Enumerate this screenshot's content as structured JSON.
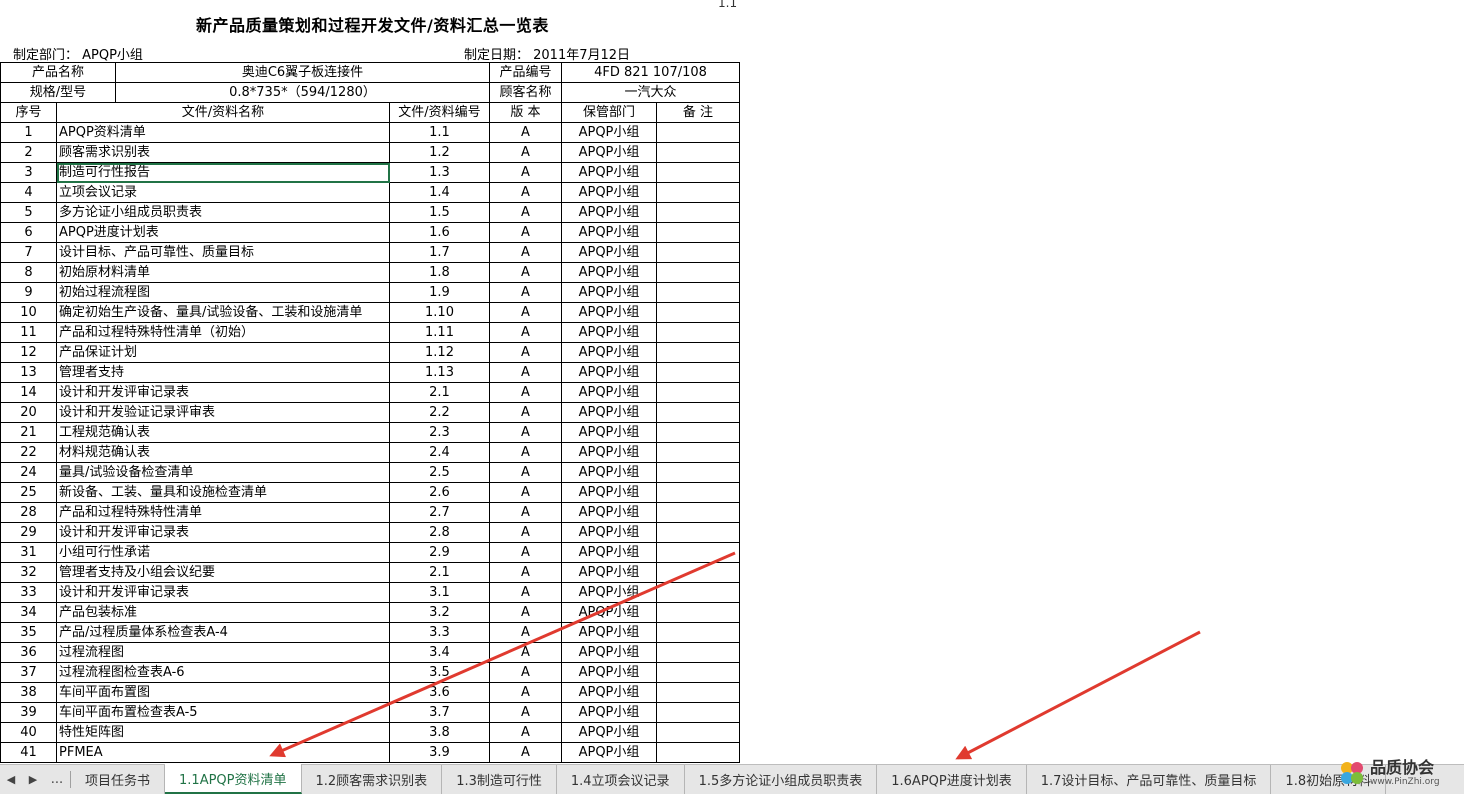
{
  "corner_label": "1.1",
  "title": "新产品质量策划和过程开发文件/资料汇总一览表",
  "dept_label": "制定部门：  APQP小组",
  "date_label": "制定日期：  2011年7月12日",
  "info": {
    "product_name_label": "产品名称",
    "product_name": "奥迪C6翼子板连接件",
    "product_no_label": "产品编号",
    "product_no": "4FD 821 107/108",
    "spec_label": "规格/型号",
    "spec": "0.8*735*（594/1280）",
    "customer_label": "顾客名称",
    "customer": "一汽大众"
  },
  "headers": [
    "序号",
    "文件/资料名称",
    "文件/资料编号",
    "版 本",
    "保管部门",
    "备 注"
  ],
  "rows": [
    [
      "1",
      "APQP资料清单",
      "1.1",
      "A",
      "APQP小组",
      ""
    ],
    [
      "2",
      "顾客需求识别表",
      "1.2",
      "A",
      "APQP小组",
      ""
    ],
    [
      "3",
      "制造可行性报告",
      "1.3",
      "A",
      "APQP小组",
      ""
    ],
    [
      "4",
      "立项会议记录",
      "1.4",
      "A",
      "APQP小组",
      ""
    ],
    [
      "5",
      "多方论证小组成员职责表",
      "1.5",
      "A",
      "APQP小组",
      ""
    ],
    [
      "6",
      "APQP进度计划表",
      "1.6",
      "A",
      "APQP小组",
      ""
    ],
    [
      "7",
      "设计目标、产品可靠性、质量目标",
      "1.7",
      "A",
      "APQP小组",
      ""
    ],
    [
      "8",
      "初始原材料清单",
      "1.8",
      "A",
      "APQP小组",
      ""
    ],
    [
      "9",
      "初始过程流程图",
      "1.9",
      "A",
      "APQP小组",
      ""
    ],
    [
      "10",
      "确定初始生产设备、量具/试验设备、工装和设施清单",
      "1.10",
      "A",
      "APQP小组",
      ""
    ],
    [
      "11",
      "产品和过程特殊特性清单（初始）",
      "1.11",
      "A",
      "APQP小组",
      ""
    ],
    [
      "12",
      "产品保证计划",
      "1.12",
      "A",
      "APQP小组",
      ""
    ],
    [
      "13",
      "管理者支持",
      "1.13",
      "A",
      "APQP小组",
      ""
    ],
    [
      "14",
      "设计和开发评审记录表",
      "2.1",
      "A",
      "APQP小组",
      ""
    ],
    [
      "20",
      "设计和开发验证记录评审表",
      "2.2",
      "A",
      "APQP小组",
      ""
    ],
    [
      "21",
      "工程规范确认表",
      "2.3",
      "A",
      "APQP小组",
      ""
    ],
    [
      "22",
      "材料规范确认表",
      "2.4",
      "A",
      "APQP小组",
      ""
    ],
    [
      "24",
      "量具/试验设备检查清单",
      "2.5",
      "A",
      "APQP小组",
      ""
    ],
    [
      "25",
      "新设备、工装、量具和设施检查清单",
      "2.6",
      "A",
      "APQP小组",
      ""
    ],
    [
      "28",
      "产品和过程特殊特性清单",
      "2.7",
      "A",
      "APQP小组",
      ""
    ],
    [
      "29",
      "设计和开发评审记录表",
      "2.8",
      "A",
      "APQP小组",
      ""
    ],
    [
      "31",
      "小组可行性承诺",
      "2.9",
      "A",
      "APQP小组",
      ""
    ],
    [
      "32",
      "管理者支持及小组会议纪要",
      "2.1",
      "A",
      "APQP小组",
      ""
    ],
    [
      "33",
      "设计和开发评审记录表",
      "3.1",
      "A",
      "APQP小组",
      ""
    ],
    [
      "34",
      "产品包装标准",
      "3.2",
      "A",
      "APQP小组",
      ""
    ],
    [
      "35",
      "产品/过程质量体系检查表A-4",
      "3.3",
      "A",
      "APQP小组",
      ""
    ],
    [
      "36",
      "过程流程图",
      "3.4",
      "A",
      "APQP小组",
      ""
    ],
    [
      "37",
      "过程流程图检查表A-6",
      "3.5",
      "A",
      "APQP小组",
      ""
    ],
    [
      "38",
      "车间平面布置图",
      "3.6",
      "A",
      "APQP小组",
      ""
    ],
    [
      "39",
      "车间平面布置检查表A-5",
      "3.7",
      "A",
      "APQP小组",
      ""
    ],
    [
      "40",
      "特性矩阵图",
      "3.8",
      "A",
      "APQP小组",
      ""
    ],
    [
      "41",
      "PFMEA",
      "3.9",
      "A",
      "APQP小组",
      ""
    ]
  ],
  "tabs": {
    "nav_more": "...",
    "items": [
      "项目任务书",
      "1.1APQP资料清单",
      "1.2顾客需求识别表",
      "1.3制造可行性",
      "1.4立项会议记录",
      "1.5多方论证小组成员职责表",
      "1.6APQP进度计划表",
      "1.7设计目标、产品可靠性、质量目标",
      "1.8初始原材料"
    ],
    "active_index": 1
  },
  "logo": {
    "name": "品质协会",
    "url": "www.PinZhi.org"
  },
  "colors": {
    "accent": "#217346",
    "arrow": "#e03a2f"
  }
}
